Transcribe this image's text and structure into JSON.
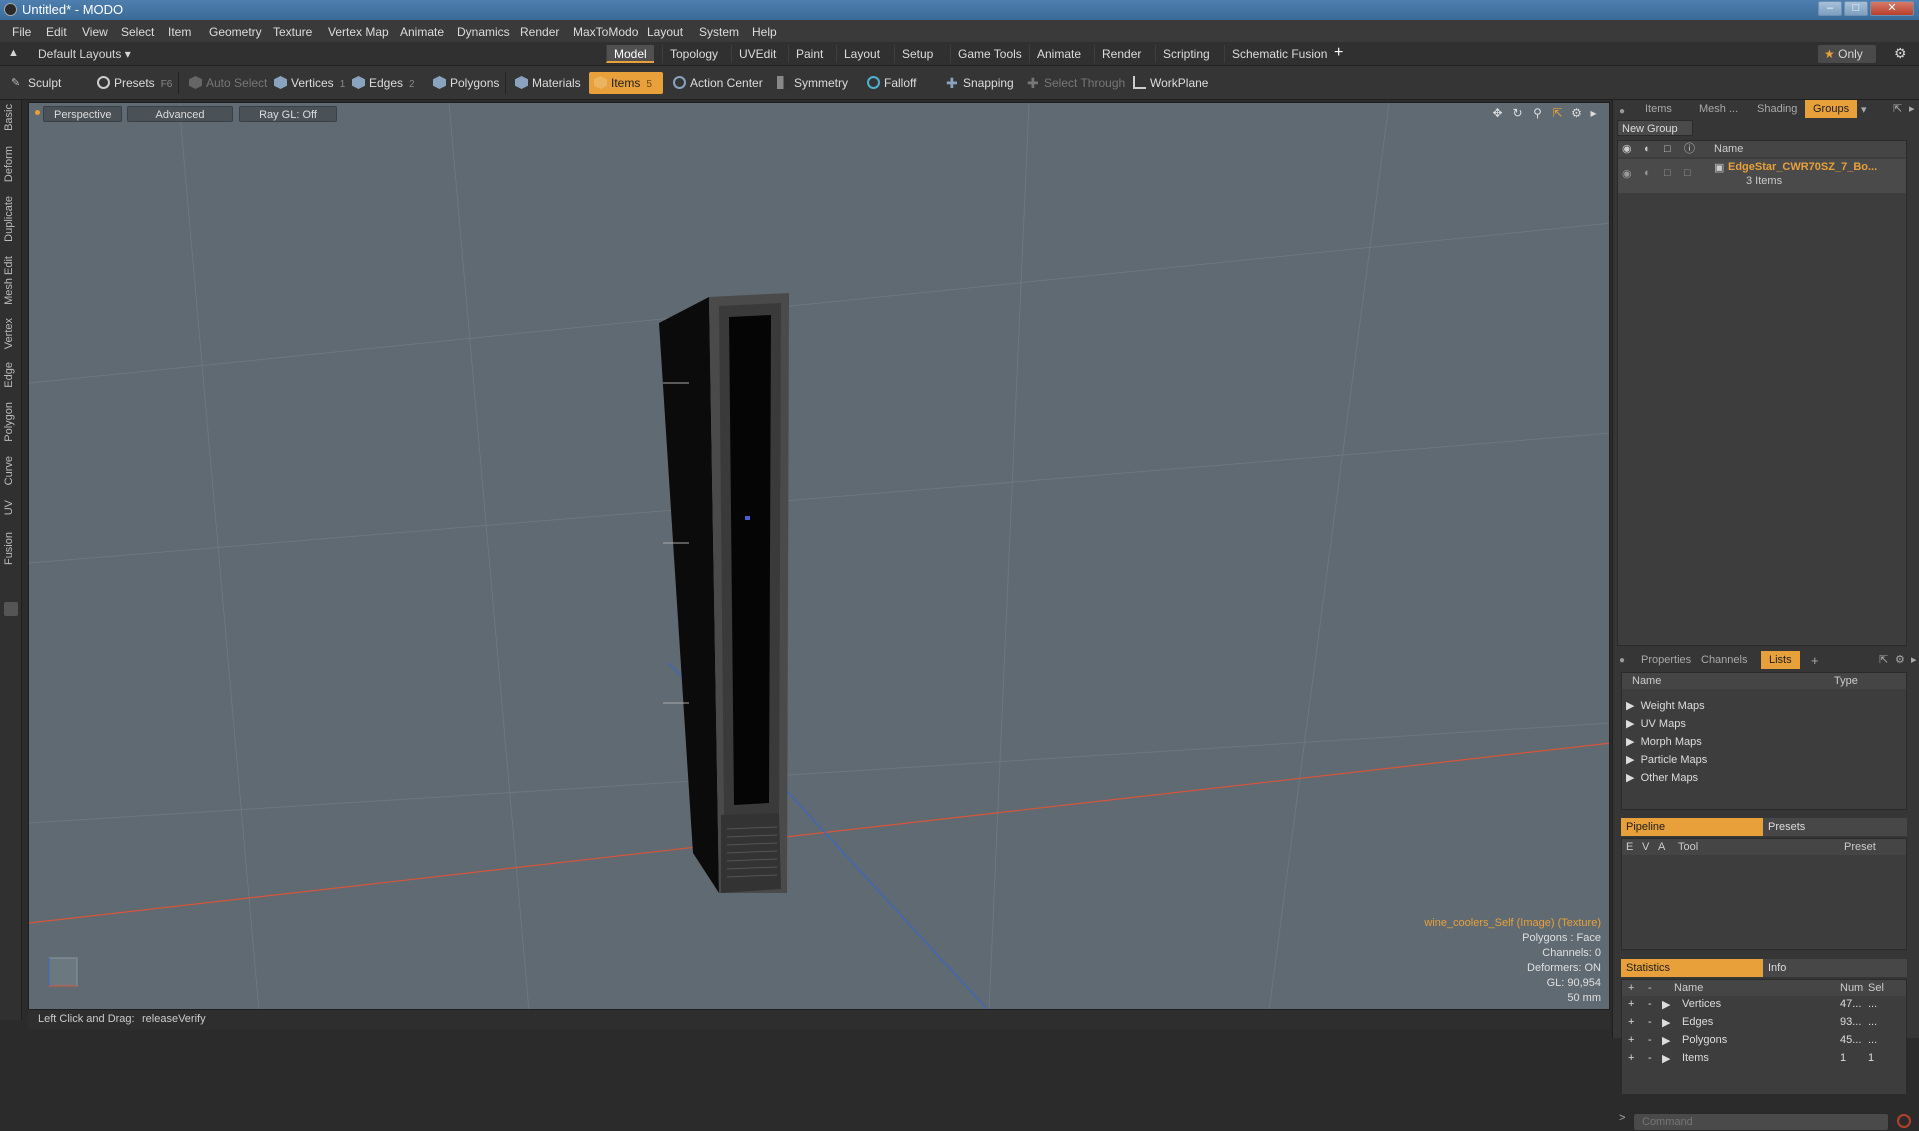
{
  "window": {
    "title": "Untitled* - MODO"
  },
  "menu": [
    "File",
    "Edit",
    "View",
    "Select",
    "Item",
    "Geometry",
    "Texture",
    "Vertex Map",
    "Animate",
    "Dynamics",
    "Render",
    "MaxToModo",
    "Layout",
    "System",
    "Help"
  ],
  "layout_bar": {
    "layouts_dropdown": "Default Layouts",
    "tabs": [
      "Model",
      "Topology",
      "UVEdit",
      "Paint",
      "Layout",
      "Setup",
      "Game Tools",
      "Animate",
      "Render",
      "Scripting",
      "Schematic Fusion"
    ],
    "active_tab": "Model",
    "add_tab": "+",
    "only_label": "Only"
  },
  "toolbar": {
    "sculpt": "Sculpt",
    "presets": "Presets",
    "presets_key": "F6",
    "auto_select": "Auto Select",
    "vertices": "Vertices",
    "vertices_key": "1",
    "edges": "Edges",
    "edges_key": "2",
    "polygons": "Polygons",
    "materials": "Materials",
    "items": "Items",
    "items_key": "5",
    "action_center": "Action Center",
    "symmetry": "Symmetry",
    "falloff": "Falloff",
    "snapping": "Snapping",
    "select_through": "Select Through",
    "workplane": "WorkPlane"
  },
  "left_tabs": [
    "Basic",
    "Deform",
    "Duplicate",
    "Mesh Edit",
    "Vertex",
    "Edge",
    "Polygon",
    "Curve",
    "UV",
    "Fusion"
  ],
  "viewport": {
    "view_mode": "Perspective",
    "shading": "Advanced",
    "raygl": "Ray GL: Off",
    "hud": {
      "texture": "wine_coolers_Self (Image) (Texture)",
      "polygons": "Polygons : Face",
      "channels": "Channels: 0",
      "deformers": "Deformers: ON",
      "gl": "GL: 90,954",
      "focal": "50 mm"
    }
  },
  "status": {
    "hint": "Left Click and Drag:",
    "action": "releaseVerify"
  },
  "right_panel": {
    "top_tabs": [
      "Items",
      "Mesh ...",
      "Shading",
      "Groups"
    ],
    "active_top_tab": "Groups",
    "new_group": "New Group",
    "groups_header": "Name",
    "group_item": {
      "name": "EdgeStar_CWR70SZ_7_Bo...",
      "count": "3 Items"
    },
    "mid_tabs": [
      "Properties",
      "Channels",
      "Lists"
    ],
    "active_mid_tab": "Lists",
    "lists_header": {
      "name": "Name",
      "type": "Type"
    },
    "lists_items": [
      "Weight Maps",
      "UV Maps",
      "Morph Maps",
      "Particle Maps",
      "Other Maps"
    ],
    "pipeline_tabs": [
      "Pipeline",
      "Presets"
    ],
    "pipeline_header": {
      "e": "E",
      "v": "V",
      "a": "A",
      "tool": "Tool",
      "preset": "Preset"
    },
    "stats_tabs": [
      "Statistics",
      "Info"
    ],
    "stats_header": {
      "name": "Name",
      "num": "Num",
      "sel": "Sel"
    },
    "stats_rows": [
      {
        "name": "Vertices",
        "num": "47...",
        "sel": "..."
      },
      {
        "name": "Edges",
        "num": "93...",
        "sel": "..."
      },
      {
        "name": "Polygons",
        "num": "45...",
        "sel": "..."
      },
      {
        "name": "Items",
        "num": "1",
        "sel": "1"
      }
    ],
    "command_placeholder": "Command"
  },
  "colors": {
    "accent": "#e8a13a",
    "viewport_bg": "#5f6a72",
    "x_axis": "#d9553a",
    "z_axis": "#3b66c4"
  }
}
